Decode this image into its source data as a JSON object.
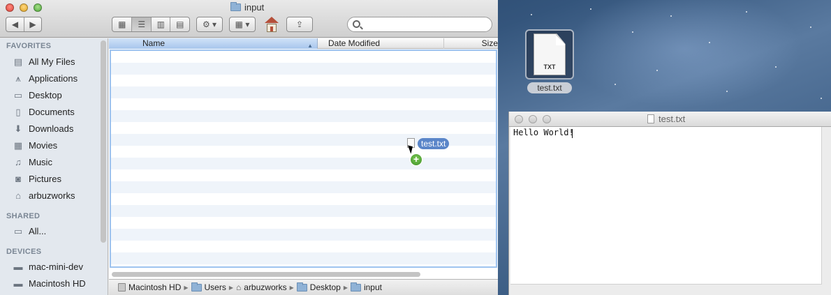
{
  "desktop": {
    "icon_label": "test.txt",
    "icon_type": "TXT"
  },
  "finder": {
    "title": "input",
    "search_placeholder": "",
    "view_modes": [
      "icon-view",
      "list-view",
      "column-view",
      "cover-flow-view"
    ],
    "active_view": "list-view",
    "sidebar": {
      "favorites_heading": "FAVORITES",
      "favorites": [
        {
          "label": "All My Files",
          "icon": "all-files-icon"
        },
        {
          "label": "Applications",
          "icon": "applications-icon"
        },
        {
          "label": "Desktop",
          "icon": "desktop-icon"
        },
        {
          "label": "Documents",
          "icon": "documents-icon"
        },
        {
          "label": "Downloads",
          "icon": "downloads-icon"
        },
        {
          "label": "Movies",
          "icon": "movies-icon"
        },
        {
          "label": "Music",
          "icon": "music-icon"
        },
        {
          "label": "Pictures",
          "icon": "pictures-icon"
        },
        {
          "label": "arbuzworks",
          "icon": "home-icon"
        }
      ],
      "shared_heading": "SHARED",
      "shared": [
        {
          "label": "All...",
          "icon": "network-icon"
        }
      ],
      "devices_heading": "DEVICES",
      "devices": [
        {
          "label": "mac-mini-dev",
          "icon": "disk-icon"
        },
        {
          "label": "Macintosh HD",
          "icon": "hard-drive-icon"
        }
      ]
    },
    "columns": {
      "name": "Name",
      "date_modified": "Date Modified",
      "size": "Size"
    },
    "path": [
      "Macintosh HD",
      "Users",
      "arbuzworks",
      "Desktop",
      "input"
    ]
  },
  "drag": {
    "label": "test.txt"
  },
  "textedit": {
    "title": "test.txt",
    "content": "Hello World!"
  }
}
